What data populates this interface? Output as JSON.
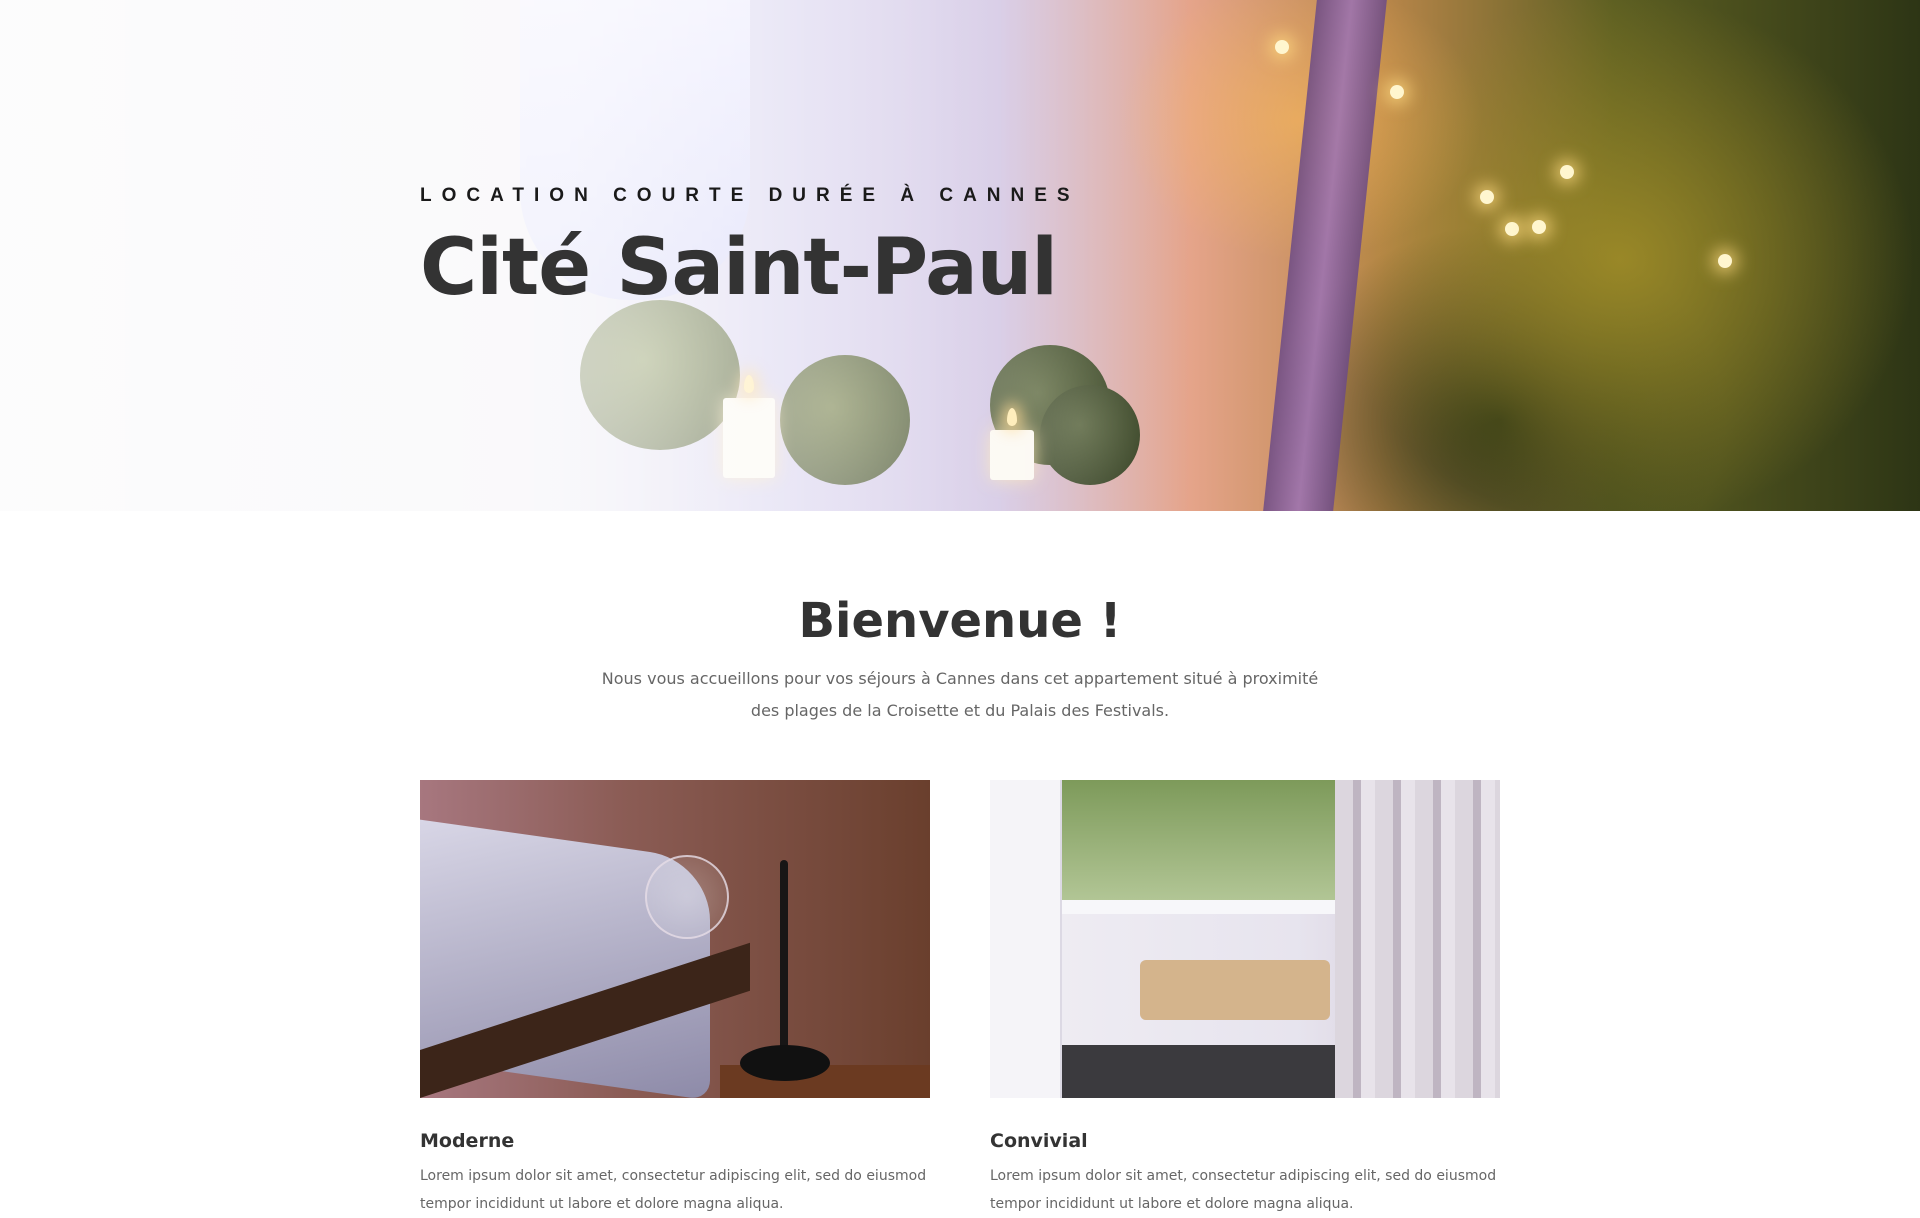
{
  "hero": {
    "kicker": "LOCATION COURTE DURÉE À CANNES",
    "title": "Cité Saint-Paul"
  },
  "welcome": {
    "title": "Bienvenue !",
    "text": "Nous vous accueillons pour vos séjours à Cannes dans cet appartement situé à proximité des plages de la Croisette et du Palais des Festivals."
  },
  "cards": [
    {
      "image_icon": "bedroom-photo",
      "title": "Moderne",
      "text": "Lorem ipsum dolor sit amet, consectetur adipiscing elit, sed do eiusmod tempor incididunt ut labore et dolore magna aliqua."
    },
    {
      "image_icon": "balcony-photo",
      "title": "Convivial",
      "text": "Lorem ipsum dolor sit amet, consectetur adipiscing elit, sed do eiusmod tempor incididunt ut labore et dolore magna aliqua."
    }
  ],
  "colors": {
    "heading": "#333333",
    "body_text": "#666666",
    "kicker": "#1a1a1a"
  }
}
